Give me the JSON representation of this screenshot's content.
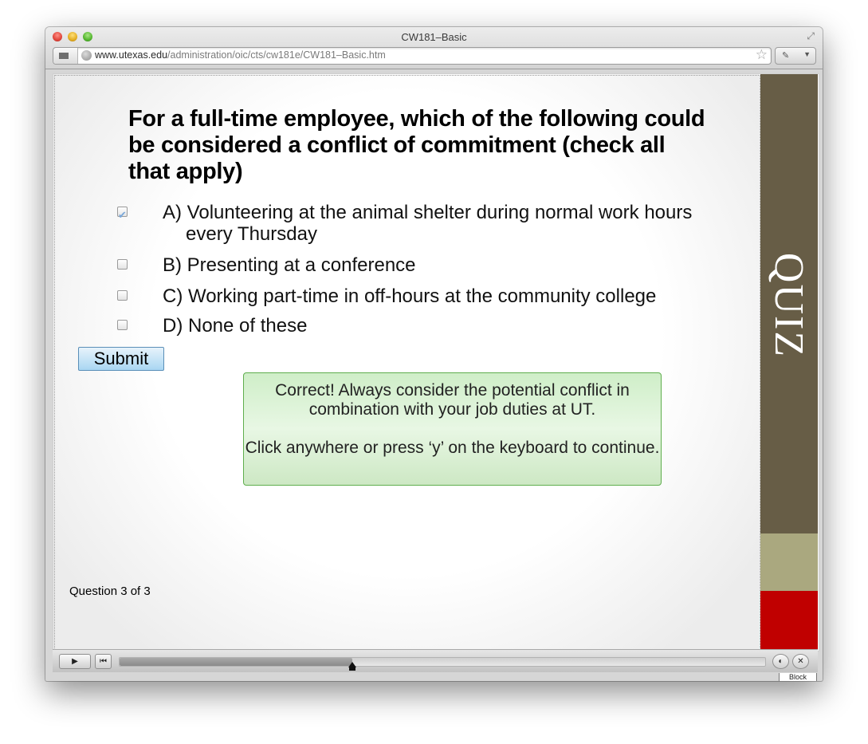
{
  "window": {
    "title": "CW181–Basic"
  },
  "address_bar": {
    "url_host": "www.utexas.edu",
    "url_path": "/administration/oic/cts/cw181e/CW181–Basic.htm"
  },
  "quiz": {
    "question": "For a full-time employee, which of the following could be considered a conflict of commitment (check all that apply)",
    "options": [
      {
        "label": "A) Volunteering at the animal shelter during normal work hours every Thursday",
        "checked": true
      },
      {
        "label": "B) Presenting at a conference",
        "checked": false
      },
      {
        "label": "C) Working part-time in off-hours at the community college",
        "checked": false
      },
      {
        "label": "D) None of these",
        "checked": false
      }
    ],
    "submit_label": "Submit",
    "feedback": {
      "line1": "Correct! Always consider the potential conflict in combination with your job duties at UT.",
      "line2": "Click anywhere or press ‘y’ on the keyboard to continue."
    },
    "progress_text": "Question 3 of 3",
    "sidebar_label": "QUIZ"
  },
  "player": {
    "progress_fraction": 0.36,
    "tab_label": "Block"
  },
  "colors": {
    "sidebar_brown": "#675d46",
    "sidebar_tan": "#aaa87f",
    "sidebar_red": "#c00000",
    "feedback_green": "#cfeec8",
    "submit_blue": "#a9d6f2"
  }
}
